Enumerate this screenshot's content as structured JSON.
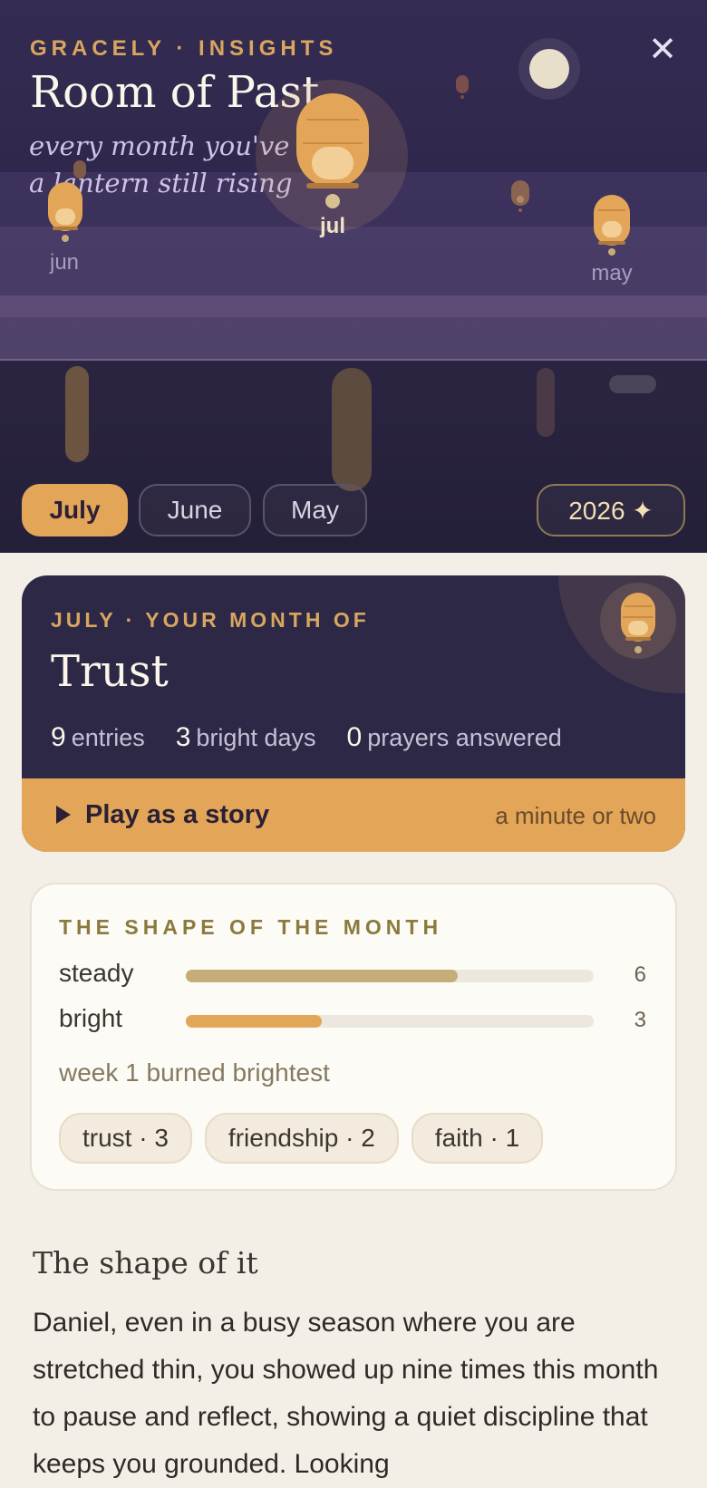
{
  "header": {
    "eyebrow": "GRACELY · INSIGHTS",
    "title": "Room of Past",
    "subtitle_line1": "every month you've li",
    "subtitle_line2": "a lantern still rising",
    "close_icon": "close-icon"
  },
  "lanterns": [
    {
      "label": "jul",
      "current": true
    },
    {
      "label": "jun",
      "current": false
    },
    {
      "label": "may",
      "current": false
    }
  ],
  "month_tabs": [
    {
      "label": "July",
      "active": true
    },
    {
      "label": "June",
      "active": false
    },
    {
      "label": "May",
      "active": false
    }
  ],
  "year_button": {
    "label": "2026 ✦"
  },
  "month_card": {
    "eyebrow": "JULY · YOUR MONTH OF",
    "title": "Trust",
    "stats": [
      {
        "value": "9",
        "label": "entries"
      },
      {
        "value": "3",
        "label": "bright days"
      },
      {
        "value": "0",
        "label": "prayers answered"
      }
    ],
    "play_label": "Play as a story",
    "play_duration": "a minute or two"
  },
  "shape_card": {
    "eyebrow": "THE SHAPE OF THE MONTH",
    "bars": [
      {
        "label": "steady",
        "count": "6",
        "value": 6,
        "max": 9,
        "color": "#c4ad78"
      },
      {
        "label": "bright",
        "count": "3",
        "value": 3,
        "max": 9,
        "color": "#e3a659"
      }
    ],
    "note": "week 1 burned brightest",
    "chips": [
      "trust · 3",
      "friendship · 2",
      "faith · 1"
    ]
  },
  "story": {
    "heading": "The shape of it",
    "body": "Daniel, even in a busy season where you are stretched thin, you showed up nine times this month to pause and reflect, showing a quiet discipline that keeps you grounded. Looking"
  },
  "colors": {
    "accent": "#e3a659",
    "hero_bg": "#2e274a",
    "card_bg": "#2d2845",
    "page_bg": "#f4efe6"
  }
}
